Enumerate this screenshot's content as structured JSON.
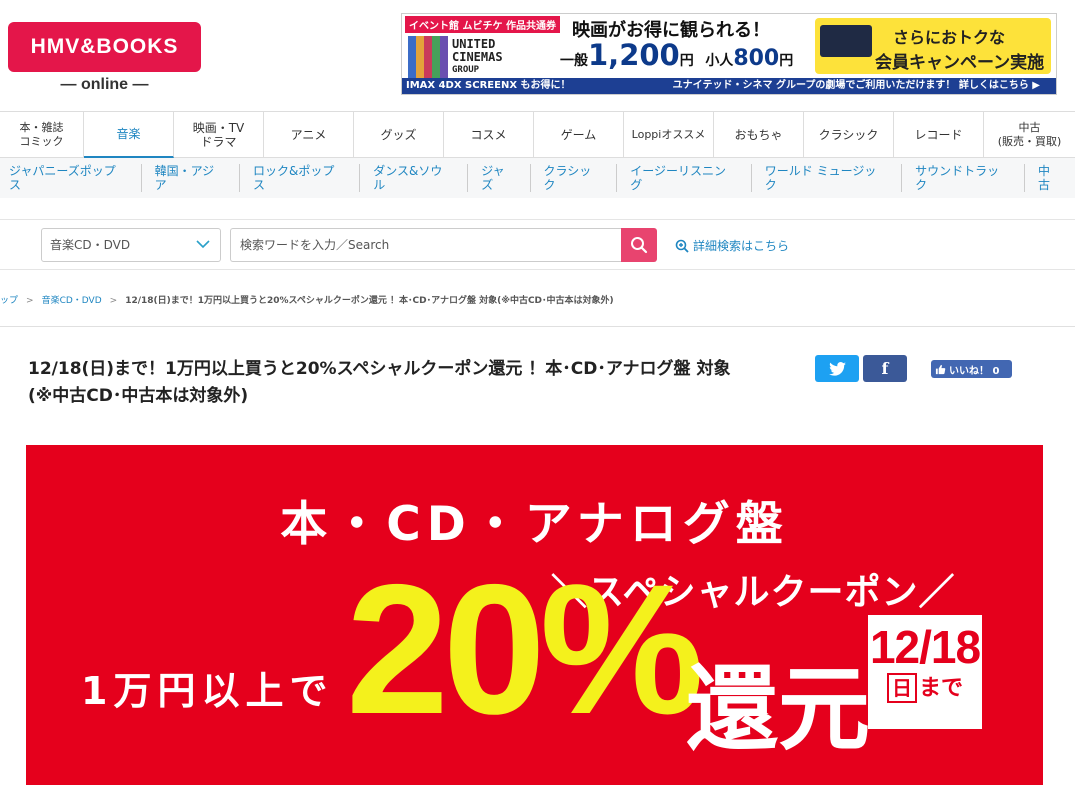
{
  "header": {
    "logo_main": "HMV&BOOKS",
    "logo_sub": "— online —"
  },
  "ad": {
    "tag": "イベント館 ムビチケ 作品共通券",
    "cinema_name_1": "UNITED",
    "cinema_name_2": "CINEMAS",
    "cinema_name_3": "GROUP",
    "headline": "映画がお得に観られる！",
    "price_adult_label": "一般",
    "price_adult": "1,200",
    "price_yen": "円",
    "price_child_label": "小人",
    "price_child": "800",
    "price_yen2": "円",
    "right_line1": "さらにおトクな",
    "right_line2": "会員キャンペーン実施中！",
    "bar_left": "IMAX 4DX SCREENX もお得に！",
    "bar_right": "ユナイテッド・シネマ グループの劇場でご利用いただけます！ 詳しくはこちら ▶"
  },
  "nav": {
    "items": [
      {
        "label": "本・雑誌\nコミック"
      },
      {
        "label": "音楽"
      },
      {
        "label": "映画・TV\nドラマ"
      },
      {
        "label": "アニメ"
      },
      {
        "label": "グッズ"
      },
      {
        "label": "コスメ"
      },
      {
        "label": "ゲーム"
      },
      {
        "label": "Loppiオススメ"
      },
      {
        "label": "おもちゃ"
      },
      {
        "label": "クラシック"
      },
      {
        "label": "レコード"
      },
      {
        "label": "中古\n(販売・買取)"
      }
    ],
    "active_index": 1
  },
  "subnav": {
    "items": [
      "ジャパニーズポップス",
      "韓国・アジア",
      "ロック&ポップス",
      "ダンス&ソウル",
      "ジャズ",
      "クラシック",
      "イージーリスニング",
      "ワールド ミュージック",
      "サウンドトラック",
      "中古"
    ]
  },
  "search": {
    "category": "音楽CD・DVD",
    "placeholder": "検索ワードを入力／Search",
    "advanced": "詳細検索はこちら"
  },
  "breadcrumb": {
    "items": [
      "ップ",
      "音楽CD・DVD"
    ],
    "current": "12/18(日)まで！1万円以上買うと20%スペシャルクーポン還元 ！本･CD･アナログ盤 対象(※中古CD･中古本は対象外)"
  },
  "article": {
    "title": "12/18(日)まで！1万円以上買うと20%スペシャルクーポン還元 ！本･CD･アナログ盤 対象(※中古CD･中古本は対象外)",
    "like_label": "いいね！ 0"
  },
  "banner": {
    "top": "本・CD・アナログ盤",
    "special": "＼スペシャルクーポン／",
    "threshold": "1万円以上で",
    "percent": "20%",
    "return": "還元",
    "date": "12/18",
    "day": "日",
    "until": "まで"
  },
  "colors": {
    "brand": "#e4164a",
    "link": "#1f86c1",
    "banner_red": "#e5001c",
    "banner_yellow": "#f4f11c",
    "twitter": "#1da1f2",
    "facebook": "#3b5998"
  }
}
